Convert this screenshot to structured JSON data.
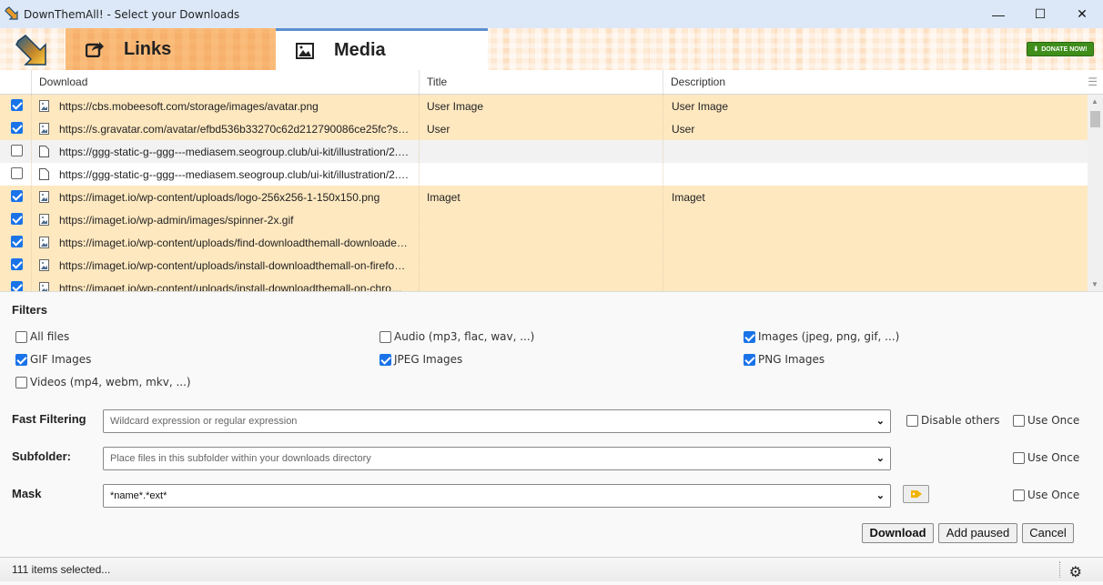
{
  "window": {
    "title": "DownThemAll! - Select your Downloads",
    "minimize": "—",
    "maximize": "☐",
    "close": "✕"
  },
  "tabs": [
    {
      "label": "Links",
      "icon": "share-icon",
      "active": false
    },
    {
      "label": "Media",
      "icon": "image-icon",
      "active": true
    }
  ],
  "donate": {
    "label": "DONATE NOW!"
  },
  "table": {
    "columns": [
      "Download",
      "Title",
      "Description"
    ],
    "rows": [
      {
        "checked": true,
        "type": "image",
        "url": "https://cbs.mobeesoft.com/storage/images/avatar.png",
        "title": "User Image",
        "description": "User Image"
      },
      {
        "checked": true,
        "type": "image",
        "url": "https://s.gravatar.com/avatar/efbd536b33270c62d212790086ce25fc?s…",
        "title": "User",
        "description": "User"
      },
      {
        "checked": false,
        "type": "file",
        "url": "https://ggg-static-g--ggg---mediasem.seogroup.club/ui-kit/illustration/2.…",
        "title": "",
        "description": ""
      },
      {
        "checked": false,
        "type": "file",
        "url": "https://ggg-static-g--ggg---mediasem.seogroup.club/ui-kit/illustration/2.…",
        "title": "",
        "description": ""
      },
      {
        "checked": true,
        "type": "image",
        "url": "https://imaget.io/wp-content/uploads/logo-256x256-1-150x150.png",
        "title": "Imaget",
        "description": "Imaget"
      },
      {
        "checked": true,
        "type": "image",
        "url": "https://imaget.io/wp-admin/images/spinner-2x.gif",
        "title": "",
        "description": ""
      },
      {
        "checked": true,
        "type": "image",
        "url": "https://imaget.io/wp-content/uploads/find-downloadthemall-downloade…",
        "title": "",
        "description": ""
      },
      {
        "checked": true,
        "type": "image",
        "url": "https://imaget.io/wp-content/uploads/install-downloadthemall-on-firefo…",
        "title": "",
        "description": ""
      },
      {
        "checked": true,
        "type": "image",
        "url": "https://imaget.io/wp-content/uploads/install-downloadthemall-on-chro…",
        "title": "",
        "description": ""
      }
    ]
  },
  "filters": {
    "title": "Filters",
    "items": [
      {
        "label": "All files",
        "checked": false
      },
      {
        "label": "Audio (mp3, flac, wav, ...)",
        "checked": false
      },
      {
        "label": "Images (jpeg, png, gif, ...)",
        "checked": true
      },
      {
        "label": "GIF Images",
        "checked": true
      },
      {
        "label": "JPEG Images",
        "checked": true
      },
      {
        "label": "PNG Images",
        "checked": true
      },
      {
        "label": "Videos (mp4, webm, mkv, ...)",
        "checked": false
      }
    ]
  },
  "fast_filtering": {
    "label": "Fast Filtering",
    "placeholder": "Wildcard expression or regular expression",
    "disable_others": "Disable others",
    "use_once": "Use Once"
  },
  "subfolder": {
    "label": "Subfolder:",
    "placeholder": "Place files in this subfolder within your downloads directory",
    "use_once": "Use Once"
  },
  "mask": {
    "label": "Mask",
    "value": "*name*.*ext*",
    "use_once": "Use Once"
  },
  "buttons": {
    "download": "Download",
    "add_paused": "Add paused",
    "cancel": "Cancel"
  },
  "status": {
    "text": "111 items selected..."
  },
  "colors": {
    "selected_row": "#fee8c0",
    "checkbox": "#1a73e8",
    "donate": "#3f8e1c",
    "links_tab": "#f8b571",
    "tag_icon": "#f0b400"
  }
}
